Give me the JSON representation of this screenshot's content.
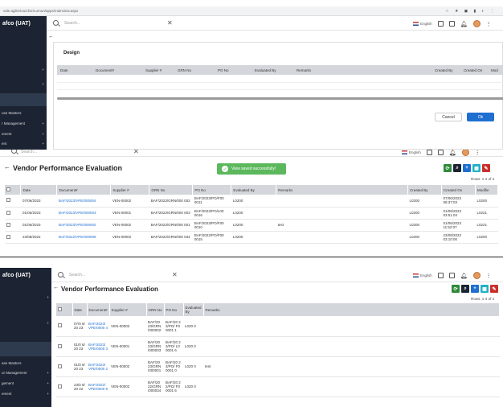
{
  "panel1": {
    "url": "vale.agilecloud.biz/Lumun/apps/mainview.aspx",
    "brand": "afco (UAT)",
    "sidebar_items": [
      {
        "label": "",
        "plus": "+"
      },
      {
        "label": "",
        "plus": "+"
      },
      {
        "label": "use Masters",
        "plus": ""
      },
      {
        "label": "r Management",
        "plus": "+"
      },
      {
        "label": "ement",
        "plus": "+"
      },
      {
        "label": "ent",
        "plus": "+"
      }
    ],
    "search_placeholder": "Search...",
    "lang": "English",
    "section": "Design",
    "columns": [
      "Date",
      "Document#",
      "Supplier #",
      "GRN No",
      "PO No",
      "Evaluated By",
      "Remarks",
      "Created By",
      "Created On",
      "Mod"
    ],
    "cancel": "Cancel",
    "ok": "Ok"
  },
  "panel2": {
    "search_placeholder": "Search...",
    "lang": "English",
    "title": "Vendor Performance Evaluation",
    "toast": "View saved successfully!",
    "rows_info": "Rows: 1-4 of 4",
    "columns": [
      "Date",
      "Document#",
      "Supplier #",
      "GRN No",
      "PO No",
      "Evaluated By",
      "Remarks",
      "Created By",
      "Created On",
      "Modifie"
    ],
    "rows": [
      {
        "date": "07/06/2023",
        "doc": "BAF/2023/VPE/000004",
        "supplier": "VEN-00002",
        "grn": "BAF/2023/GRN/000 002",
        "po": "BAF/2023/PO/F00 0011",
        "eval": "L0200",
        "remarks": "",
        "created_by": "L0200",
        "created_on": "07/06/2023 08:37:03",
        "mod": "L0200"
      },
      {
        "date": "01/06/2023",
        "doc": "BAF/2023/VPE/000003",
        "supplier": "VEN-00001",
        "grn": "BAF/2023/GRN/000 003",
        "po": "BAF/2023/PO/L00 0016",
        "eval": "L0200",
        "remarks": "",
        "created_by": "L0200",
        "created_on": "01/06/2023 03:51:04",
        "mod": "L0221"
      },
      {
        "date": "01/06/2023",
        "doc": "BAF/2023/VPE/000002",
        "supplier": "VEN-00002",
        "grn": "BAF/2023/GRN/000 001",
        "po": "BAF/2023/PO/F00 0010",
        "eval": "L0200",
        "remarks": "test",
        "created_by": "L0200",
        "created_on": "01/06/2023 11:52:07",
        "mod": "L0221"
      },
      {
        "date": "23/08/2022",
        "doc": "BAF/2022/VPE/000008",
        "supplier": "VEN-00002",
        "grn": "BAF/2022/GRN/000 034",
        "po": "BAF/2022/PO/F00 0015",
        "eval": "L0200",
        "remarks": "",
        "created_by": "L0200",
        "created_on": "23/08/2022 03:10:00",
        "mod": "L0200"
      }
    ]
  },
  "panel3": {
    "brand": "afco (UAT)",
    "search_placeholder": "Search...",
    "lang": "English",
    "title": "Vendor Performance Evaluation",
    "rows_info": "Rows: 1-4 of 4",
    "sidebar_items": [
      {
        "label": "",
        "plus": "+"
      },
      {
        "label": "",
        "plus": "+"
      },
      {
        "label": "ase Masters",
        "plus": ""
      },
      {
        "label": "or Management",
        "plus": "+"
      },
      {
        "label": "gement",
        "plus": "+"
      },
      {
        "label": "ement",
        "plus": "+"
      }
    ],
    "columns": [
      "Date",
      "Document#",
      "Supplier #",
      "GRN No",
      "PO No",
      "Evaluated By",
      "Remarks"
    ],
    "rows": [
      {
        "date": "07/0 6/20 23",
        "doc": "BAF/2023/ VPE/0000 4",
        "supplier": "VEN-00002",
        "grn": "BAF/20 23/GRN /000002",
        "po": "BAF/20 23/PO/ F00001 1",
        "eval": "L020 0",
        "remarks": ""
      },
      {
        "date": "01/0 6/20 23",
        "doc": "BAF/2023/ VPE/0000 3",
        "supplier": "VEN-00001",
        "grn": "BAF/20 23/GRN /000003",
        "po": "BAF/20 23/PO/ L00001 6",
        "eval": "L020 0",
        "remarks": ""
      },
      {
        "date": "01/0 6/20 23",
        "doc": "BAF/2023/ VPE/0000 2",
        "supplier": "VEN-00002",
        "grn": "BAF/20 23/GRN /000001",
        "po": "BAF/20 23/PO/ F00001 0",
        "eval": "L020 0",
        "remarks": "test"
      },
      {
        "date": "23/0 8/20 22",
        "doc": "BAF/2022/ VPE/0000 8",
        "supplier": "VEN-00002",
        "grn": "BAF/20 22/GRN /000034",
        "po": "BAF/20 22/PO/ F00001 5",
        "eval": "L020 0",
        "remarks": ""
      }
    ]
  },
  "colors": {
    "sidebar": "#1c2433",
    "accent": "#1e6fd0",
    "green": "#2e8b3a",
    "teal": "#25b0c8",
    "red": "#c9302c",
    "header": "#d3d7dc"
  }
}
